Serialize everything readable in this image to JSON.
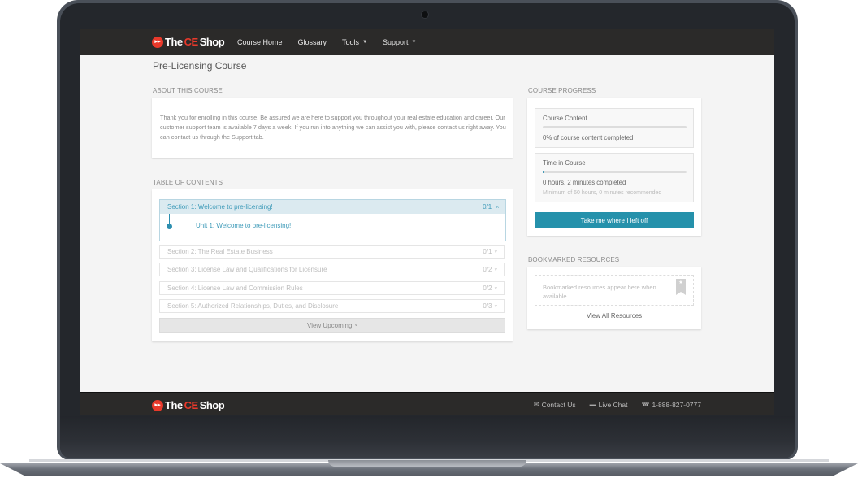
{
  "brand": {
    "name_part1": "The",
    "name_part2": "CE",
    "name_part3": "Shop",
    "badge_glyph": "▸▸",
    "accent_color": "#e8392b",
    "primary_color": "#2591ab"
  },
  "nav": {
    "items": [
      {
        "label": "Course Home",
        "has_caret": false
      },
      {
        "label": "Glossary",
        "has_caret": false
      },
      {
        "label": "Tools",
        "has_caret": true
      },
      {
        "label": "Support",
        "has_caret": true
      }
    ],
    "caret_glyph": "▼"
  },
  "page": {
    "title": "Pre-Licensing Course"
  },
  "about": {
    "heading": "About This Course",
    "text": "Thank you for enrolling in this course. Be assured we are here to support you throughout your real estate education and career. Our customer support team is available 7 days a week. If you run into anything we can assist you with, please contact us right away. You can contact us through the Support tab."
  },
  "toc": {
    "heading": "Table of Contents",
    "open_section": {
      "title": "Section 1: Welcome to pre-licensing!",
      "count": "0/1",
      "chevron": "˄",
      "units": [
        {
          "title": "Unit 1: Welcome to pre-licensing!"
        }
      ]
    },
    "sections": [
      {
        "title": "Section 2: The Real Estate Business",
        "count": "0/1"
      },
      {
        "title": "Section 3: License Law and Qualifications for Licensure",
        "count": "0/2"
      },
      {
        "title": "Section 4: License Law and Commission Rules",
        "count": "0/2"
      },
      {
        "title": "Section 5: Authorized Relationships, Duties, and Disclosure",
        "count": "0/3"
      }
    ],
    "collapsed_chevron": "˅",
    "view_upcoming_label": "View Upcoming"
  },
  "progress": {
    "heading": "Course Progress",
    "content": {
      "title": "Course Content",
      "percent_complete": 0,
      "text": "0% of course content completed"
    },
    "time": {
      "title": "Time in Course",
      "percent_complete": 0.6,
      "text": "0 hours, 2 minutes completed",
      "subtext": "Minimum of 60 hours, 0 minutes recommended"
    },
    "resume_button": "Take me where I left off"
  },
  "bookmarks": {
    "heading": "Bookmarked Resources",
    "empty_text": "Bookmarked resources appear here when available",
    "icon_glyph": "★",
    "view_all_label": "View All Resources"
  },
  "footer": {
    "links": [
      {
        "icon": "envelope-icon",
        "glyph": "✉",
        "label": "Contact Us"
      },
      {
        "icon": "chat-icon",
        "glyph": "▬",
        "label": "Live Chat"
      },
      {
        "icon": "phone-icon",
        "glyph": "☎",
        "label": "1-888-827-0777"
      }
    ]
  }
}
